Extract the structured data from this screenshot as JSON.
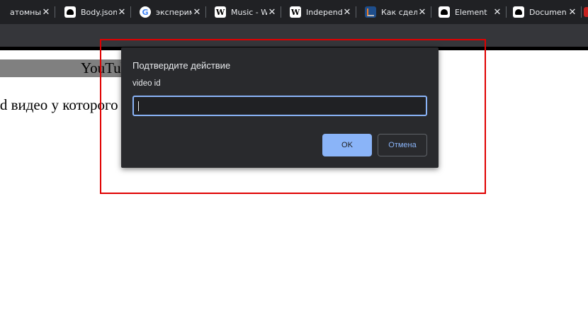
{
  "browser": {
    "tabs": [
      {
        "label": "атомные",
        "icon": "google-icon"
      },
      {
        "label": "Body.json",
        "icon": "github-icon"
      },
      {
        "label": "эксперим",
        "icon": "google-icon"
      },
      {
        "label": "Music - W",
        "icon": "wikipedia-icon"
      },
      {
        "label": "Independ",
        "icon": "wikipedia-icon"
      },
      {
        "label": "Как сдел",
        "icon": "stackoverflow-icon"
      },
      {
        "label": "Element",
        "icon": "github-icon"
      },
      {
        "label": "Documen",
        "icon": "github-icon"
      }
    ],
    "close_glyph": "✕"
  },
  "page": {
    "heading": "YouTube",
    "text": "id видео у которого"
  },
  "dialog": {
    "title": "Подтвердите действие",
    "message": "video id",
    "input_value": "",
    "ok_label": "OK",
    "cancel_label": "Отмена"
  },
  "colors": {
    "accent": "#8ab4f8",
    "dialog_bg": "#292a2d",
    "highlight": "#e00000"
  }
}
